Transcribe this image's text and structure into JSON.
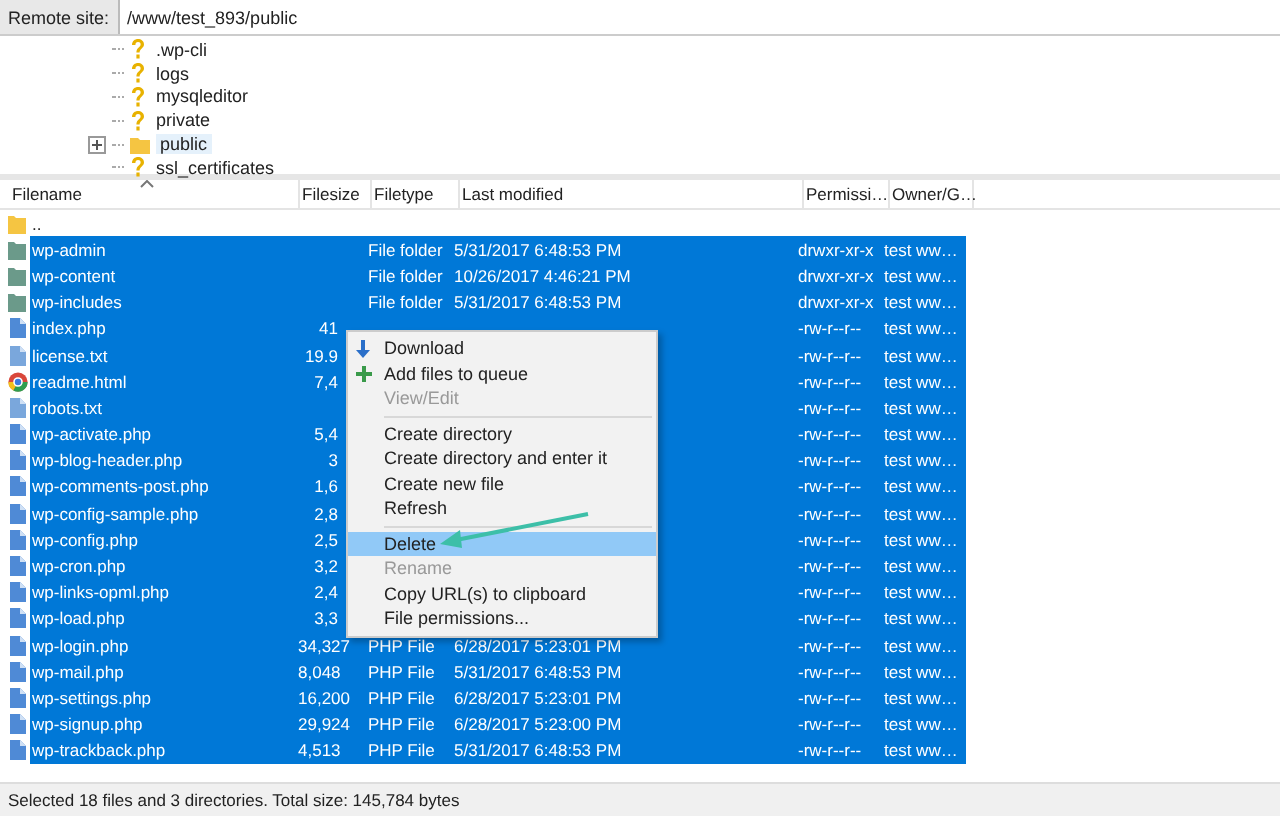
{
  "remote_site": {
    "label": "Remote site:",
    "path": "/www/test_893/public"
  },
  "tree": [
    {
      "name": ".wp-cli",
      "kind": "unknown",
      "selected": false,
      "expandable": false
    },
    {
      "name": "logs",
      "kind": "unknown",
      "selected": false,
      "expandable": false
    },
    {
      "name": "mysqleditor",
      "kind": "unknown",
      "selected": false,
      "expandable": false
    },
    {
      "name": "private",
      "kind": "unknown",
      "selected": false,
      "expandable": false
    },
    {
      "name": "public",
      "kind": "folder",
      "selected": true,
      "expandable": true
    },
    {
      "name": "ssl_certificates",
      "kind": "unknown",
      "selected": false,
      "expandable": false
    }
  ],
  "file_list": {
    "columns": [
      "Filename",
      "Filesize",
      "Filetype",
      "Last modified",
      "Permissi…",
      "Owner/G…"
    ],
    "rows": [
      {
        "name": "..",
        "kind": "parent",
        "selected": false
      },
      {
        "name": "wp-admin",
        "kind": "folder",
        "selected": true,
        "type": "File folder",
        "modified": "5/31/2017 6:48:53 PM",
        "permissions": "drwxr-xr-x",
        "owner": "test ww…"
      },
      {
        "name": "wp-content",
        "kind": "folder",
        "selected": true,
        "type": "File folder",
        "modified": "10/26/2017 4:46:21 PM",
        "permissions": "drwxr-xr-x",
        "owner": "test ww…"
      },
      {
        "name": "wp-includes",
        "kind": "folder",
        "selected": true,
        "type": "File folder",
        "modified": "5/31/2017 6:48:53 PM",
        "permissions": "drwxr-xr-x",
        "owner": "test ww…"
      },
      {
        "name": "index.php",
        "kind": "php",
        "selected": true,
        "size": "41",
        "permissions": "-rw-r--r--",
        "owner": "test ww…"
      },
      {
        "name": "license.txt",
        "kind": "txt",
        "selected": true,
        "size": "19.9",
        "permissions": "-rw-r--r--",
        "owner": "test ww…"
      },
      {
        "name": "readme.html",
        "kind": "html",
        "selected": true,
        "size": "7,4",
        "permissions": "-rw-r--r--",
        "owner": "test ww…"
      },
      {
        "name": "robots.txt",
        "kind": "txt",
        "selected": true,
        "permissions": "-rw-r--r--",
        "owner": "test ww…"
      },
      {
        "name": "wp-activate.php",
        "kind": "php",
        "selected": true,
        "size": "5,4",
        "permissions": "-rw-r--r--",
        "owner": "test ww…"
      },
      {
        "name": "wp-blog-header.php",
        "kind": "php",
        "selected": true,
        "size": "3",
        "permissions": "-rw-r--r--",
        "owner": "test ww…"
      },
      {
        "name": "wp-comments-post.php",
        "kind": "php",
        "selected": true,
        "size": "1,6",
        "permissions": "-rw-r--r--",
        "owner": "test ww…"
      },
      {
        "name": "wp-config-sample.php",
        "kind": "php",
        "selected": true,
        "size": "2,8",
        "permissions": "-rw-r--r--",
        "owner": "test ww…"
      },
      {
        "name": "wp-config.php",
        "kind": "php",
        "selected": true,
        "size": "2,5",
        "permissions": "-rw-r--r--",
        "owner": "test ww…"
      },
      {
        "name": "wp-cron.php",
        "kind": "php",
        "selected": true,
        "size": "3,2",
        "permissions": "-rw-r--r--",
        "owner": "test ww…"
      },
      {
        "name": "wp-links-opml.php",
        "kind": "php",
        "selected": true,
        "size": "2,4",
        "permissions": "-rw-r--r--",
        "owner": "test ww…"
      },
      {
        "name": "wp-load.php",
        "kind": "php",
        "selected": true,
        "size": "3,3",
        "permissions": "-rw-r--r--",
        "owner": "test ww…"
      },
      {
        "name": "wp-login.php",
        "kind": "php",
        "selected": true,
        "size": "34,327",
        "type": "PHP File",
        "modified": "6/28/2017 5:23:01 PM",
        "permissions": "-rw-r--r--",
        "owner": "test ww…"
      },
      {
        "name": "wp-mail.php",
        "kind": "php",
        "selected": true,
        "size": "8,048",
        "type": "PHP File",
        "modified": "5/31/2017 6:48:53 PM",
        "permissions": "-rw-r--r--",
        "owner": "test ww…"
      },
      {
        "name": "wp-settings.php",
        "kind": "php",
        "selected": true,
        "size": "16,200",
        "type": "PHP File",
        "modified": "6/28/2017 5:23:01 PM",
        "permissions": "-rw-r--r--",
        "owner": "test ww…"
      },
      {
        "name": "wp-signup.php",
        "kind": "php",
        "selected": true,
        "size": "29,924",
        "type": "PHP File",
        "modified": "6/28/2017 5:23:00 PM",
        "permissions": "-rw-r--r--",
        "owner": "test ww…"
      },
      {
        "name": "wp-trackback.php",
        "kind": "php",
        "selected": true,
        "size": "4,513",
        "type": "PHP File",
        "modified": "5/31/2017 6:48:53 PM",
        "permissions": "-rw-r--r--",
        "owner": "test ww…"
      }
    ]
  },
  "context_menu": {
    "items": [
      {
        "kind": "item",
        "label": "Download",
        "disabled": false,
        "selected": false
      },
      {
        "kind": "item",
        "label": "Add files to queue",
        "disabled": false,
        "selected": false
      },
      {
        "kind": "item",
        "label": "View/Edit",
        "disabled": true,
        "selected": false
      },
      {
        "kind": "separator"
      },
      {
        "kind": "item",
        "label": "Create directory",
        "disabled": false,
        "selected": false
      },
      {
        "kind": "item",
        "label": "Create directory and enter it",
        "disabled": false,
        "selected": false
      },
      {
        "kind": "item",
        "label": "Create new file",
        "disabled": false,
        "selected": false
      },
      {
        "kind": "item",
        "label": "Refresh",
        "disabled": false,
        "selected": false
      },
      {
        "kind": "separator"
      },
      {
        "kind": "item",
        "label": "Delete",
        "disabled": false,
        "selected": true
      },
      {
        "kind": "item",
        "label": "Rename",
        "disabled": true,
        "selected": false
      },
      {
        "kind": "item",
        "label": "Copy URL(s) to clipboard",
        "disabled": false,
        "selected": false
      },
      {
        "kind": "item",
        "label": "File permissions...",
        "disabled": false,
        "selected": false
      }
    ]
  },
  "status_bar": "Selected 18 files and 3 directories. Total size: 145,784 bytes"
}
